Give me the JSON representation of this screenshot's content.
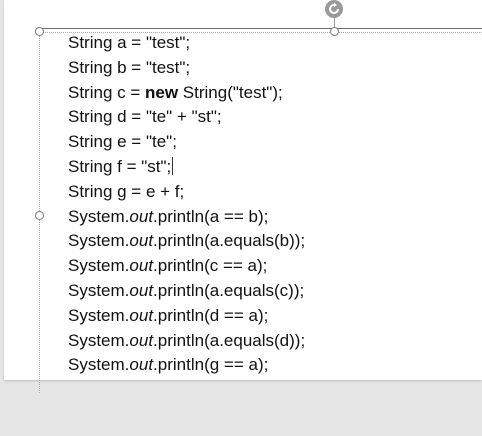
{
  "slide": {
    "title": "",
    "code_lines": [
      {
        "parts": [
          {
            "text": "String a = \"test\";"
          }
        ]
      },
      {
        "parts": [
          {
            "text": "String b = \"test\";"
          }
        ]
      },
      {
        "parts": [
          {
            "text": "String c = "
          },
          {
            "text": "new",
            "style": "bold"
          },
          {
            "text": " String(\"test\");"
          }
        ]
      },
      {
        "parts": [
          {
            "text": "String d = \"te\" + \"st\";"
          }
        ]
      },
      {
        "parts": [
          {
            "text": "String e = \"te\";"
          }
        ]
      },
      {
        "parts": [
          {
            "text": "String f = \"st\";"
          }
        ],
        "caret": true
      },
      {
        "parts": [
          {
            "text": "String g = e + f;"
          }
        ]
      },
      {
        "parts": [
          {
            "text": "System."
          },
          {
            "text": "out",
            "style": "italic"
          },
          {
            "text": ".println(a == b);"
          }
        ]
      },
      {
        "parts": [
          {
            "text": "System."
          },
          {
            "text": "out",
            "style": "italic"
          },
          {
            "text": ".println(a.equals(b));"
          }
        ]
      },
      {
        "parts": [
          {
            "text": "System."
          },
          {
            "text": "out",
            "style": "italic"
          },
          {
            "text": ".println(c == a);"
          }
        ]
      },
      {
        "parts": [
          {
            "text": "System."
          },
          {
            "text": "out",
            "style": "italic"
          },
          {
            "text": ".println(a.equals(c));"
          }
        ]
      },
      {
        "parts": [
          {
            "text": "System."
          },
          {
            "text": "out",
            "style": "italic"
          },
          {
            "text": ".println(d == a);"
          }
        ]
      },
      {
        "parts": [
          {
            "text": "System."
          },
          {
            "text": "out",
            "style": "italic"
          },
          {
            "text": ".println(a.equals(d));"
          }
        ]
      },
      {
        "parts": [
          {
            "text": "System."
          },
          {
            "text": "out",
            "style": "italic"
          },
          {
            "text": ".println(g == a);"
          }
        ]
      }
    ]
  },
  "icons": {
    "rotate": "rotate-icon",
    "resize": "resize-handle-icon"
  },
  "colors": {
    "title": "#2b2e8a",
    "text": "#111111",
    "workspace": "#e6e6e6",
    "handle": "#9a9a9a"
  }
}
